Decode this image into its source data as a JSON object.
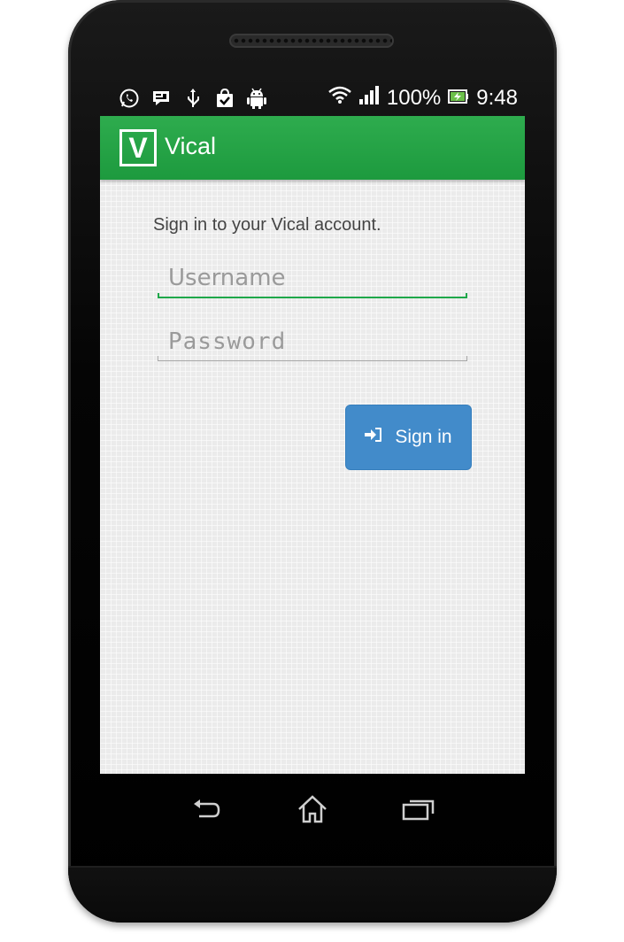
{
  "status_bar": {
    "left_icons": [
      "whatsapp-icon",
      "chat-icon",
      "usb-icon",
      "shopping-bag-icon",
      "android-icon"
    ],
    "wifi_icon": "wifi-icon",
    "signal_icon": "signal-bars-icon",
    "battery_percent": "100%",
    "battery_icon": "battery-charging-icon",
    "time": "9:48"
  },
  "action_bar": {
    "logo_letter": "V",
    "title": "Vical",
    "color": "#25a548"
  },
  "login": {
    "intro": "Sign in to your Vical account.",
    "username": {
      "placeholder": "Username",
      "value": ""
    },
    "password": {
      "placeholder": "Password",
      "value": ""
    },
    "sign_in_label": "Sign in",
    "sign_in_icon": "sign-in-icon",
    "button_color": "#428bca",
    "focus_color": "#1fa84a"
  },
  "nav_bar": {
    "back_icon": "back-icon",
    "home_icon": "home-icon",
    "recents_icon": "recents-icon"
  }
}
